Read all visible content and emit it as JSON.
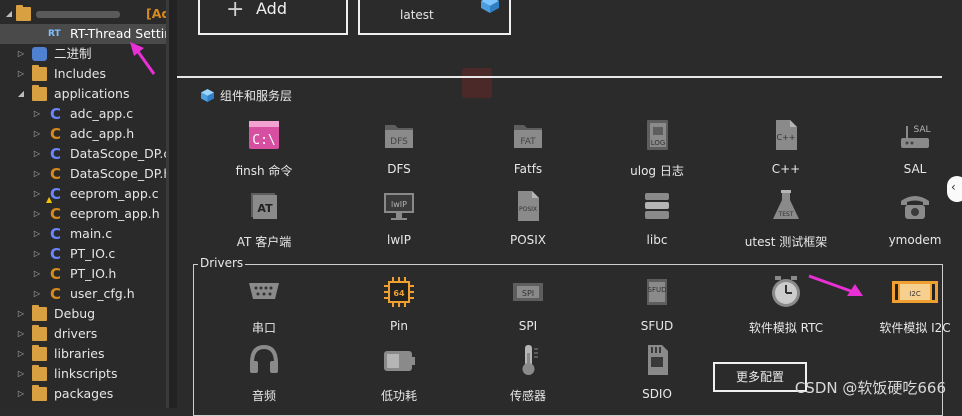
{
  "tree": {
    "project_label": "[Ad",
    "rows": [
      {
        "label": "RT-Thread Settings",
        "icon": "rt-settings-icon",
        "level": 2,
        "expander": "",
        "selected": true
      },
      {
        "label": "二进制",
        "icon": "binaries-icon",
        "level": 1,
        "expander": "right"
      },
      {
        "label": "Includes",
        "icon": "includes-folder-icon",
        "level": 1,
        "expander": "right"
      },
      {
        "label": "applications",
        "icon": "folder-icon",
        "level": 1,
        "expander": "down"
      },
      {
        "label": "adc_app.c",
        "icon": "c-source-icon",
        "level": 2,
        "expander": "right"
      },
      {
        "label": "adc_app.h",
        "icon": "c-header-icon",
        "level": 2,
        "expander": "right"
      },
      {
        "label": "DataScope_DP.c",
        "icon": "c-source-icon",
        "level": 2,
        "expander": "right"
      },
      {
        "label": "DataScope_DP.h",
        "icon": "c-header-icon",
        "level": 2,
        "expander": "right"
      },
      {
        "label": "eeprom_app.c",
        "icon": "c-source-warning-icon",
        "level": 2,
        "expander": "right"
      },
      {
        "label": "eeprom_app.h",
        "icon": "c-header-icon",
        "level": 2,
        "expander": "right"
      },
      {
        "label": "main.c",
        "icon": "c-source-icon",
        "level": 2,
        "expander": "right"
      },
      {
        "label": "PT_IO.c",
        "icon": "c-source-icon",
        "level": 2,
        "expander": "right"
      },
      {
        "label": "PT_IO.h",
        "icon": "c-header-icon",
        "level": 2,
        "expander": "right"
      },
      {
        "label": "user_cfg.h",
        "icon": "c-header-icon",
        "level": 2,
        "expander": "right"
      },
      {
        "label": "Debug",
        "icon": "folder-icon",
        "level": 1,
        "expander": "right"
      },
      {
        "label": "drivers",
        "icon": "folder-icon",
        "level": 1,
        "expander": "right"
      },
      {
        "label": "libraries",
        "icon": "folder-icon",
        "level": 1,
        "expander": "right"
      },
      {
        "label": "linkscripts",
        "icon": "folder-icon",
        "level": 1,
        "expander": "right"
      },
      {
        "label": "packages",
        "icon": "folder-icon",
        "level": 1,
        "expander": "right"
      }
    ]
  },
  "top": {
    "add_label": "Add",
    "add_icon": "plus-icon",
    "latest_label": "latest",
    "latest_icon": "cube-icon"
  },
  "components": {
    "title": "组件和服务层",
    "title_icon": "cube-icon",
    "items": [
      {
        "label": "finsh 命令",
        "icon": "finsh-shell-icon",
        "active": true
      },
      {
        "label": "DFS",
        "icon": "dfs-folder-icon",
        "active": false
      },
      {
        "label": "Fatfs",
        "icon": "fat-folder-icon",
        "active": false
      },
      {
        "label": "ulog 日志",
        "icon": "log-book-icon",
        "active": false
      },
      {
        "label": "C++",
        "icon": "cpp-file-icon",
        "active": false
      },
      {
        "label": "SAL",
        "icon": "sal-router-icon",
        "active": false
      },
      {
        "label": "AT 客户端",
        "icon": "at-icon",
        "active": false
      },
      {
        "label": "lwIP",
        "icon": "lwip-monitor-icon",
        "active": false
      },
      {
        "label": "POSIX",
        "icon": "posix-file-icon",
        "active": false
      },
      {
        "label": "libc",
        "icon": "books-icon",
        "active": false
      },
      {
        "label": "utest 测试框架",
        "icon": "test-flask-icon",
        "active": false
      },
      {
        "label": "ymodem",
        "icon": "phone-icon",
        "active": false
      }
    ]
  },
  "drivers": {
    "title": "Drivers",
    "items": [
      {
        "label": "串口",
        "icon": "serial-port-icon",
        "active": false
      },
      {
        "label": "Pin",
        "icon": "chip-pin-icon",
        "active": true
      },
      {
        "label": "SPI",
        "icon": "spi-icon",
        "active": false
      },
      {
        "label": "SFUD",
        "icon": "sfud-chip-icon",
        "active": false
      },
      {
        "label": "软件模拟 RTC",
        "icon": "clock-icon",
        "active": false
      },
      {
        "label": "软件模拟 I2C",
        "icon": "i2c-icon",
        "active": true
      },
      {
        "label": "音频",
        "icon": "headphones-icon",
        "active": false
      },
      {
        "label": "低功耗",
        "icon": "battery-icon",
        "active": false
      },
      {
        "label": "传感器",
        "icon": "thermometer-icon",
        "active": false
      },
      {
        "label": "SDIO",
        "icon": "sd-card-icon",
        "active": false
      }
    ],
    "more_label": "更多配置"
  },
  "watermark": "CSDN @软饭硬吃666",
  "colors": {
    "accent_arrow": "#e830d4",
    "c_source": "#6a86ff",
    "c_header": "#d98a1c",
    "folder": "#d8a040",
    "active_orange": "#f0a030"
  }
}
